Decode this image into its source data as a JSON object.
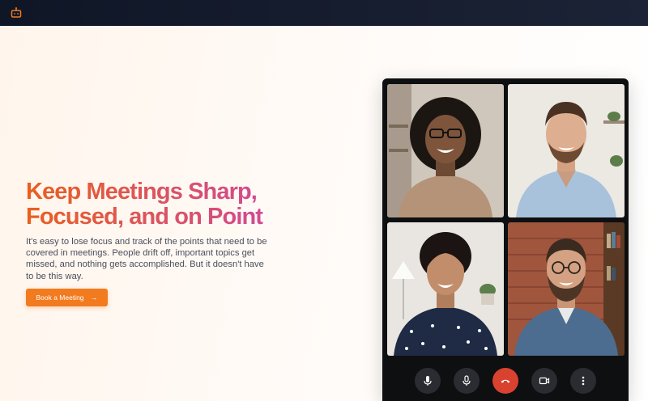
{
  "header": {
    "logo_icon": "robot-icon",
    "brand_color": "#e8601f"
  },
  "hero": {
    "headline": "Keep Meetings Sharp, Focused, and on Point",
    "description": "It's easy to lose focus and track of the points that need to be covered in meetings. People drift off, important topics get missed, and nothing gets accomplished. But it doesn't have to be this way.",
    "cta_label": "Book a Meeting",
    "cta_icon": "arrow-right-icon",
    "cta_color": "#f27a1f"
  },
  "video_call": {
    "participants": [
      {
        "icon": "participant-video-1"
      },
      {
        "icon": "participant-video-2"
      },
      {
        "icon": "participant-video-3"
      },
      {
        "icon": "participant-video-4"
      }
    ],
    "controls": [
      {
        "icon": "microphone-icon"
      },
      {
        "icon": "microphone-icon"
      },
      {
        "icon": "end-call-icon",
        "color": "#d9422e"
      },
      {
        "icon": "camera-icon"
      },
      {
        "icon": "more-options-icon"
      }
    ]
  }
}
